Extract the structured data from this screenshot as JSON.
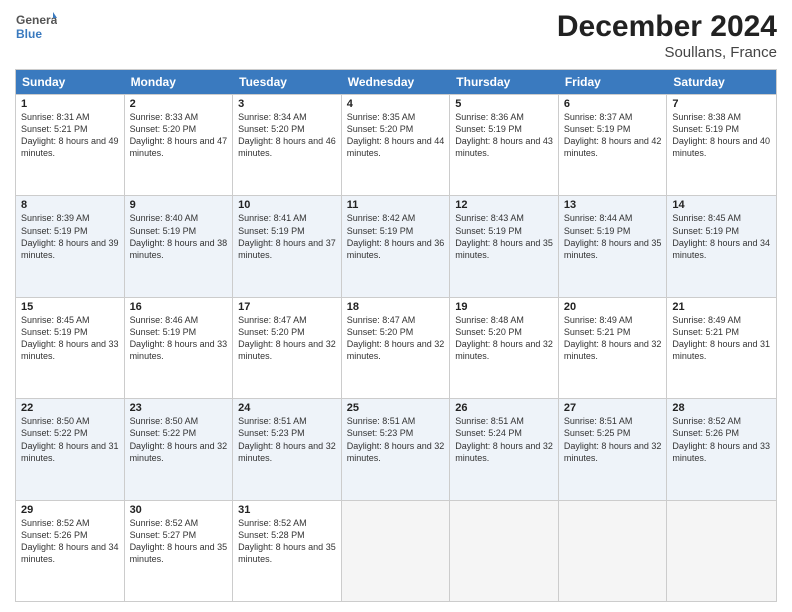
{
  "logo": {
    "general": "General",
    "blue": "Blue"
  },
  "title": "December 2024",
  "subtitle": "Soullans, France",
  "days_of_week": [
    "Sunday",
    "Monday",
    "Tuesday",
    "Wednesday",
    "Thursday",
    "Friday",
    "Saturday"
  ],
  "weeks": [
    [
      {
        "day": "1",
        "sunrise": "8:31 AM",
        "sunset": "5:21 PM",
        "daylight": "8 hours and 49 minutes."
      },
      {
        "day": "2",
        "sunrise": "8:33 AM",
        "sunset": "5:20 PM",
        "daylight": "8 hours and 47 minutes."
      },
      {
        "day": "3",
        "sunrise": "8:34 AM",
        "sunset": "5:20 PM",
        "daylight": "8 hours and 46 minutes."
      },
      {
        "day": "4",
        "sunrise": "8:35 AM",
        "sunset": "5:20 PM",
        "daylight": "8 hours and 44 minutes."
      },
      {
        "day": "5",
        "sunrise": "8:36 AM",
        "sunset": "5:19 PM",
        "daylight": "8 hours and 43 minutes."
      },
      {
        "day": "6",
        "sunrise": "8:37 AM",
        "sunset": "5:19 PM",
        "daylight": "8 hours and 42 minutes."
      },
      {
        "day": "7",
        "sunrise": "8:38 AM",
        "sunset": "5:19 PM",
        "daylight": "8 hours and 40 minutes."
      }
    ],
    [
      {
        "day": "8",
        "sunrise": "8:39 AM",
        "sunset": "5:19 PM",
        "daylight": "8 hours and 39 minutes."
      },
      {
        "day": "9",
        "sunrise": "8:40 AM",
        "sunset": "5:19 PM",
        "daylight": "8 hours and 38 minutes."
      },
      {
        "day": "10",
        "sunrise": "8:41 AM",
        "sunset": "5:19 PM",
        "daylight": "8 hours and 37 minutes."
      },
      {
        "day": "11",
        "sunrise": "8:42 AM",
        "sunset": "5:19 PM",
        "daylight": "8 hours and 36 minutes."
      },
      {
        "day": "12",
        "sunrise": "8:43 AM",
        "sunset": "5:19 PM",
        "daylight": "8 hours and 35 minutes."
      },
      {
        "day": "13",
        "sunrise": "8:44 AM",
        "sunset": "5:19 PM",
        "daylight": "8 hours and 35 minutes."
      },
      {
        "day": "14",
        "sunrise": "8:45 AM",
        "sunset": "5:19 PM",
        "daylight": "8 hours and 34 minutes."
      }
    ],
    [
      {
        "day": "15",
        "sunrise": "8:45 AM",
        "sunset": "5:19 PM",
        "daylight": "8 hours and 33 minutes."
      },
      {
        "day": "16",
        "sunrise": "8:46 AM",
        "sunset": "5:19 PM",
        "daylight": "8 hours and 33 minutes."
      },
      {
        "day": "17",
        "sunrise": "8:47 AM",
        "sunset": "5:20 PM",
        "daylight": "8 hours and 32 minutes."
      },
      {
        "day": "18",
        "sunrise": "8:47 AM",
        "sunset": "5:20 PM",
        "daylight": "8 hours and 32 minutes."
      },
      {
        "day": "19",
        "sunrise": "8:48 AM",
        "sunset": "5:20 PM",
        "daylight": "8 hours and 32 minutes."
      },
      {
        "day": "20",
        "sunrise": "8:49 AM",
        "sunset": "5:21 PM",
        "daylight": "8 hours and 32 minutes."
      },
      {
        "day": "21",
        "sunrise": "8:49 AM",
        "sunset": "5:21 PM",
        "daylight": "8 hours and 31 minutes."
      }
    ],
    [
      {
        "day": "22",
        "sunrise": "8:50 AM",
        "sunset": "5:22 PM",
        "daylight": "8 hours and 31 minutes."
      },
      {
        "day": "23",
        "sunrise": "8:50 AM",
        "sunset": "5:22 PM",
        "daylight": "8 hours and 32 minutes."
      },
      {
        "day": "24",
        "sunrise": "8:51 AM",
        "sunset": "5:23 PM",
        "daylight": "8 hours and 32 minutes."
      },
      {
        "day": "25",
        "sunrise": "8:51 AM",
        "sunset": "5:23 PM",
        "daylight": "8 hours and 32 minutes."
      },
      {
        "day": "26",
        "sunrise": "8:51 AM",
        "sunset": "5:24 PM",
        "daylight": "8 hours and 32 minutes."
      },
      {
        "day": "27",
        "sunrise": "8:51 AM",
        "sunset": "5:25 PM",
        "daylight": "8 hours and 32 minutes."
      },
      {
        "day": "28",
        "sunrise": "8:52 AM",
        "sunset": "5:26 PM",
        "daylight": "8 hours and 33 minutes."
      }
    ],
    [
      {
        "day": "29",
        "sunrise": "8:52 AM",
        "sunset": "5:26 PM",
        "daylight": "8 hours and 34 minutes."
      },
      {
        "day": "30",
        "sunrise": "8:52 AM",
        "sunset": "5:27 PM",
        "daylight": "8 hours and 35 minutes."
      },
      {
        "day": "31",
        "sunrise": "8:52 AM",
        "sunset": "5:28 PM",
        "daylight": "8 hours and 35 minutes."
      },
      null,
      null,
      null,
      null
    ]
  ],
  "labels": {
    "sunrise": "Sunrise:",
    "sunset": "Sunset:",
    "daylight": "Daylight:"
  }
}
